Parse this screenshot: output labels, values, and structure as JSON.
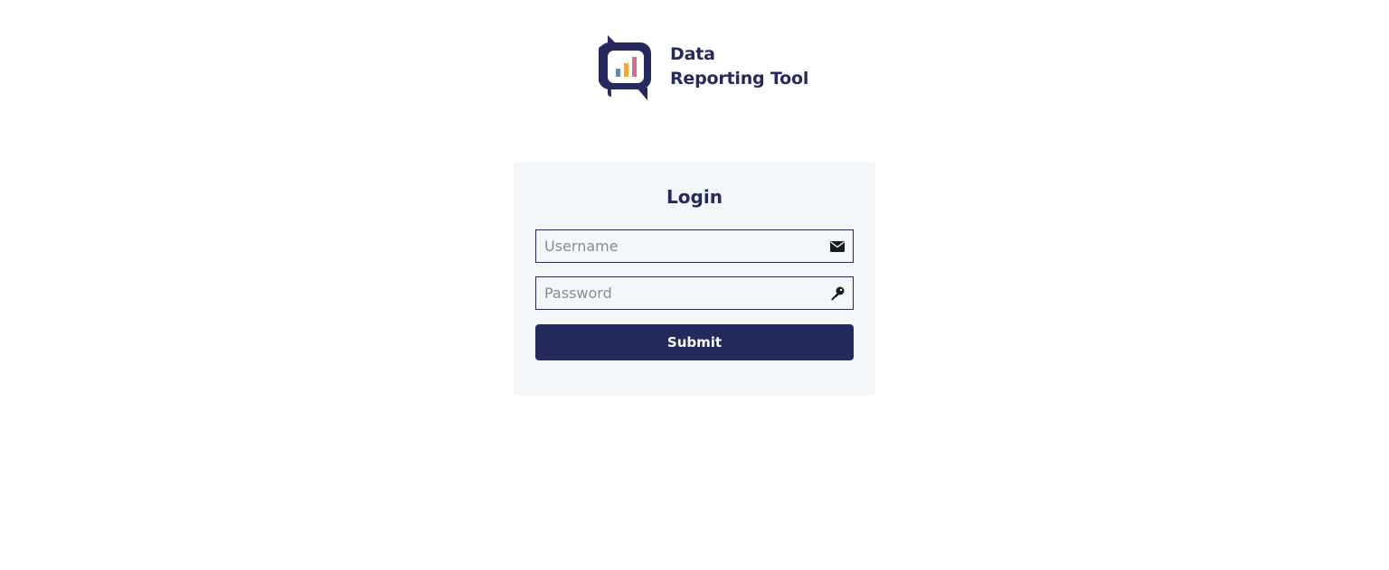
{
  "brand": {
    "line1": "Data",
    "line2": "Reporting Tool",
    "logo_icon": "chat-bar-chart-icon",
    "colors": {
      "primary": "#25295e",
      "bar_blue": "#4e8fbf",
      "bar_orange": "#f0a73c",
      "bar_pink": "#d96b8e"
    }
  },
  "login": {
    "title": "Login",
    "username_placeholder": "Username",
    "username_value": "",
    "username_icon": "envelope-icon",
    "password_placeholder": "Password",
    "password_value": "",
    "password_icon": "key-icon",
    "submit_label": "Submit"
  },
  "colors": {
    "card_background": "#f4f7fa",
    "button_background": "#25295e",
    "button_text": "#ffffff"
  }
}
